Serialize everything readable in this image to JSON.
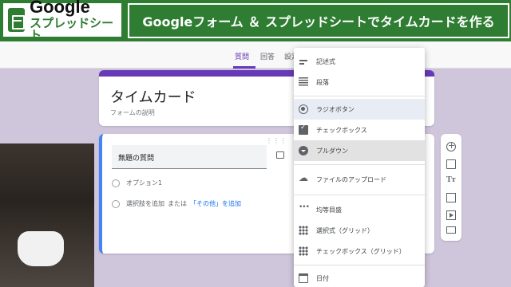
{
  "banner": {
    "logo_line1": "Google",
    "logo_line2": "スプレッドシート",
    "title": "Googleフォーム ＆ スプレッドシートでタイムカードを作る"
  },
  "tabs": [
    "質問",
    "回答",
    "設定"
  ],
  "form": {
    "title": "タイムカード",
    "description": "フォームの説明"
  },
  "question": {
    "placeholder": "無題の質問",
    "option": "オプション1",
    "add_option": "選択肢を追加",
    "or": "または",
    "add_other": "「その他」を追加"
  },
  "menu": {
    "items": [
      "記述式",
      "段落",
      "ラジオボタン",
      "チェックボックス",
      "プルダウン",
      "ファイルのアップロード",
      "均等目盛",
      "選択式（グリッド）",
      "チェックボックス（グリッド）",
      "日付"
    ]
  },
  "colors": {
    "accent": "#673ab7",
    "banner": "#2e7d32",
    "question_border": "#4285f4"
  }
}
